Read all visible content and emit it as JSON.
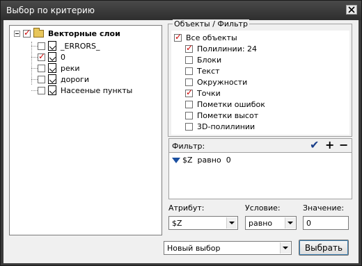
{
  "window": {
    "title": "Выбор по критерию"
  },
  "tree": {
    "root": {
      "label": "Векторные слои",
      "checked": true
    },
    "items": [
      {
        "label": "_ERRORS_",
        "checked": false
      },
      {
        "label": "0",
        "checked": true
      },
      {
        "label": "реки",
        "checked": false
      },
      {
        "label": "дороги",
        "checked": false
      },
      {
        "label": "Насееные пункты",
        "checked": false
      }
    ]
  },
  "objects": {
    "group_title": "Объекты / Фильтр",
    "all_label": "Все объекты",
    "items": [
      {
        "label": "Полилинии: 24",
        "checked": true
      },
      {
        "label": "Блоки",
        "checked": false
      },
      {
        "label": "Текст",
        "checked": false
      },
      {
        "label": "Окружности",
        "checked": false
      },
      {
        "label": "Точки",
        "checked": true
      },
      {
        "label": "Пометки ошибок",
        "checked": false
      },
      {
        "label": "Пометки высот",
        "checked": false
      },
      {
        "label": "3D-полилинии",
        "checked": false
      }
    ]
  },
  "filter": {
    "label": "Фильтр:",
    "apply_symbol": "✔",
    "add_symbol": "+",
    "remove_symbol": "−",
    "rule": {
      "attribute": "$Z",
      "condition": "равно",
      "value": "0"
    }
  },
  "form": {
    "attribute_label": "Атрибут:",
    "attribute_value": "$Z",
    "condition_label": "Условие:",
    "condition_value": "равно",
    "value_label": "Значение:",
    "value_value": "0"
  },
  "bottom": {
    "selection_mode": "Новый выбор",
    "select_button": "Выбрать"
  }
}
